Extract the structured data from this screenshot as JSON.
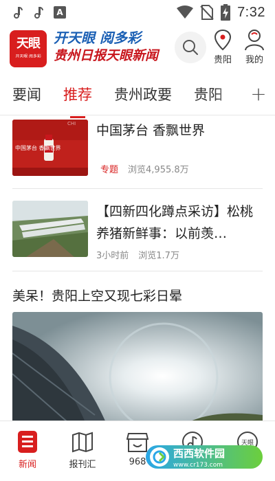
{
  "status_bar": {
    "time": "7:32",
    "left_icons": [
      "tiktok-icon",
      "tiktok-icon",
      "a-box-icon"
    ],
    "right_icons": [
      "wifi-icon",
      "no-sim-icon",
      "battery-charging-icon"
    ]
  },
  "header": {
    "logo_main": "天眼",
    "logo_sub": "开天眼 阅多彩",
    "brand_line1": "开天眼 阅多彩",
    "brand_line2": "贵州日报天眼新闻",
    "location_label": "贵阳",
    "profile_label": "我的"
  },
  "tabs": [
    {
      "label": "要闻",
      "active": false
    },
    {
      "label": "推荐",
      "active": true
    },
    {
      "label": "贵州政要",
      "active": false
    },
    {
      "label": "贵阳",
      "active": false
    }
  ],
  "tab_add_symbol": "+",
  "feed": {
    "items": [
      {
        "title": "中国茅台 香飘世界",
        "tag": "专题",
        "meta_time": "",
        "views": "浏览4,955.8万",
        "thumb_text": "中国茅台  香飘世界",
        "thumb_corner": "CHI"
      },
      {
        "title": "【四新四化蹲点采访】松桃养猪新鲜事：以前羡…",
        "tag": "",
        "meta_time": "3小时前",
        "views": "浏览1.7万"
      }
    ],
    "featured_title": "美呆！贵阳上空又现七彩日晕"
  },
  "bottom_nav": [
    {
      "label": "新闻",
      "icon": "news-icon",
      "active": true
    },
    {
      "label": "报刊汇",
      "icon": "book-icon",
      "active": false
    },
    {
      "label": "968",
      "icon": "shop-icon",
      "active": false
    },
    {
      "label": "",
      "icon": "music-icon",
      "active": false
    },
    {
      "label": "",
      "icon": "tianyan-icon",
      "active": false
    }
  ],
  "watermark": {
    "main": "西西软件园",
    "sub": "www.cr173.com"
  },
  "colors": {
    "accent": "#d81e1e",
    "brand_blue": "#1a5fb4"
  }
}
